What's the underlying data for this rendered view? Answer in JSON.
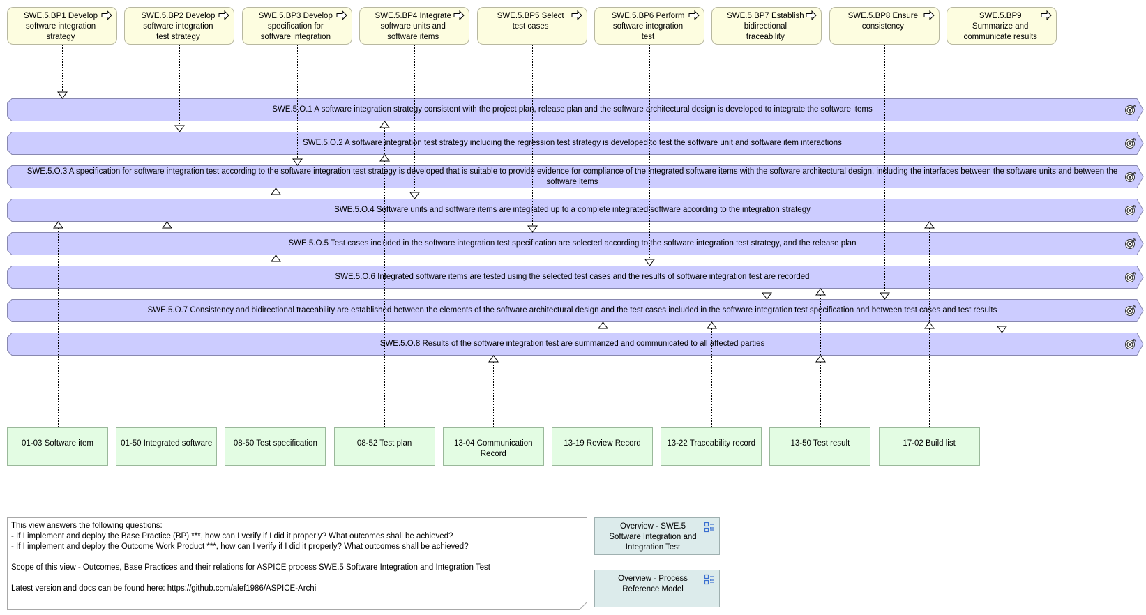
{
  "base_practices": [
    {
      "id": "BP1",
      "label": "SWE.5.BP1 Develop software integration strategy"
    },
    {
      "id": "BP2",
      "label": "SWE.5.BP2 Develop software integration test strategy"
    },
    {
      "id": "BP3",
      "label": "SWE.5.BP3 Develop specification for software integration"
    },
    {
      "id": "BP4",
      "label": "SWE.5.BP4 Integrate software units and software items"
    },
    {
      "id": "BP5",
      "label": "SWE.5.BP5 Select test cases"
    },
    {
      "id": "BP6",
      "label": "SWE.5.BP6 Perform software integration test"
    },
    {
      "id": "BP7",
      "label": "SWE.5.BP7 Establish bidirectional traceability"
    },
    {
      "id": "BP8",
      "label": "SWE.5.BP8 Ensure consistency"
    },
    {
      "id": "BP9",
      "label": "SWE.5.BP9 Summarize and communicate results"
    }
  ],
  "outcomes": [
    {
      "id": "O1",
      "label": "SWE.5.O.1 A software integration strategy consistent with the project plan, release plan and the software architectural design is developed to integrate the software items"
    },
    {
      "id": "O2",
      "label": "SWE.5.O.2 A software integration test strategy including the regression test strategy is developed to test the software unit and software item interactions"
    },
    {
      "id": "O3",
      "label": "SWE.5.O.3 A specification for software integration test according to the software integration test strategy is developed that is suitable to provide evidence for compliance of the integrated software items with the software architectural design, including the interfaces between the software units and between the software items"
    },
    {
      "id": "O4",
      "label": "SWE.5.O.4 Software units and software items are integrated up to a complete integrated software according to the integration strategy"
    },
    {
      "id": "O5",
      "label": "SWE.5.O.5 Test cases included in the software integration test specification are selected according to the software integration test strategy, and the release plan"
    },
    {
      "id": "O6",
      "label": "SWE.5.O.6 Integrated software items are tested using the selected test cases and the results of software integration test are recorded"
    },
    {
      "id": "O7",
      "label": "SWE.5.O.7 Consistency and bidirectional traceability are established between the elements of the software architectural design and the test cases included in the software integration test specification and between test cases and test results"
    },
    {
      "id": "O8",
      "label": "SWE.5.O.8 Results of the software integration test are summarized and communicated to all affected parties"
    }
  ],
  "work_products": [
    {
      "id": "WP0103",
      "label": "01-03 Software item"
    },
    {
      "id": "WP0150",
      "label": "01-50 Integrated software"
    },
    {
      "id": "WP0850",
      "label": "08-50 Test specification"
    },
    {
      "id": "WP0852",
      "label": "08-52 Test plan"
    },
    {
      "id": "WP1304",
      "label": "13-04 Communication Record"
    },
    {
      "id": "WP1319",
      "label": "13-19 Review Record"
    },
    {
      "id": "WP1322",
      "label": "13-22 Traceability record"
    },
    {
      "id": "WP1350",
      "label": "13-50 Test result"
    },
    {
      "id": "WP1702",
      "label": "17-02 Build list"
    }
  ],
  "relations": {
    "bp_to_outcome": [
      [
        "BP1",
        "O1"
      ],
      [
        "BP2",
        "O2"
      ],
      [
        "BP3",
        "O3"
      ],
      [
        "BP4",
        "O4"
      ],
      [
        "BP5",
        "O5"
      ],
      [
        "BP6",
        "O6"
      ],
      [
        "BP7",
        "O7"
      ],
      [
        "BP8",
        "O7"
      ],
      [
        "BP9",
        "O8"
      ]
    ],
    "workproduct_to_outcome": [
      [
        "WP0103",
        "O4"
      ],
      [
        "WP0150",
        "O4"
      ],
      [
        "WP0850",
        "O3"
      ],
      [
        "WP0850",
        "O5"
      ],
      [
        "WP0852",
        "O1"
      ],
      [
        "WP0852",
        "O2"
      ],
      [
        "WP1304",
        "O8"
      ],
      [
        "WP1319",
        "O7"
      ],
      [
        "WP1322",
        "O7"
      ],
      [
        "WP1350",
        "O6"
      ],
      [
        "WP1350",
        "O8"
      ],
      [
        "WP1702",
        "O4"
      ],
      [
        "WP1702",
        "O7"
      ]
    ]
  },
  "note": {
    "lines": [
      "This view answers the following questions:",
      "- If I implement and deploy the Base Practice (BP) ***, how can I verify if I did it properly? What outcomes shall be achieved?",
      "- If I implement and deploy the Outcome Work Product ***, how can I verify if I did it properly? What outcomes shall be achieved?",
      "",
      "Scope of this view - Outcomes, Base Practices and their relations for ASPICE process SWE.5 Software Integration and Integration Test",
      "",
      "Latest version and docs can be found here: https://github.com/alef1986/ASPICE-Archi"
    ]
  },
  "view_references": [
    {
      "label": "Overview - SWE.5 Software Integration and Integration Test",
      "icon": "view-reference-icon"
    },
    {
      "label": "Overview - Process Reference Model",
      "icon": "view-reference-icon"
    }
  ],
  "colors": {
    "base_practice_fill": "#fdfde0",
    "outcome_fill": "#ccccff",
    "outcome_stroke": "#8888b0",
    "work_product_fill": "#e3fce3",
    "reference_fill": "#dcebeb"
  }
}
